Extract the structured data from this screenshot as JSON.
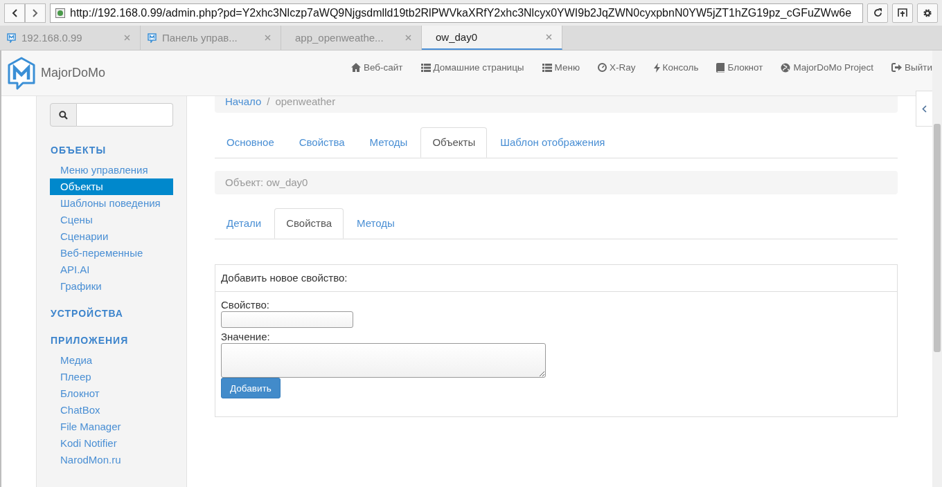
{
  "browser": {
    "url": "http://192.168.0.99/admin.php?pd=Y2xhc3Nlczp7aWQ9Njgsdmlld19tb2RlPWVkaXRfY2xhc3Nlcyx0YWI9b2JqZWN0cyxpbnN0YW5jZT1hZG19pz_cGFuZWw6e",
    "tabs": [
      {
        "label": "192.168.0.99",
        "favicon": true,
        "selected": false
      },
      {
        "label": "Панель управ...",
        "favicon": true,
        "selected": false
      },
      {
        "label": "app_openweathe...",
        "favicon": false,
        "selected": false
      },
      {
        "label": "ow_day0",
        "favicon": false,
        "selected": true
      }
    ]
  },
  "navbar": {
    "brand": "MajorDoMo",
    "links": [
      {
        "label": "Веб-сайт",
        "kind": "home"
      },
      {
        "label": "Домашние страницы",
        "kind": "list"
      },
      {
        "label": "Меню",
        "kind": "list"
      },
      {
        "label": "X-Ray",
        "kind": "gauge"
      },
      {
        "label": "Консоль",
        "kind": "bolt"
      },
      {
        "label": "Блокнот",
        "kind": "book"
      },
      {
        "label": "MajorDoMo Project",
        "kind": "globe"
      },
      {
        "label": "Выйти",
        "kind": "signout"
      }
    ]
  },
  "sidebar": {
    "sections": [
      {
        "title": "ОБЪЕКТЫ",
        "items": [
          {
            "label": "Меню управления",
            "selected": false
          },
          {
            "label": "Объекты",
            "selected": true
          },
          {
            "label": "Шаблоны поведения",
            "selected": false
          },
          {
            "label": "Сцены",
            "selected": false
          },
          {
            "label": "Сценарии",
            "selected": false
          },
          {
            "label": "Веб-переменные",
            "selected": false
          },
          {
            "label": "API.AI",
            "selected": false
          },
          {
            "label": "Графики",
            "selected": false
          }
        ]
      },
      {
        "title": "УСТРОЙСТВА"
      },
      {
        "title": "ПРИЛОЖЕНИЯ",
        "items": [
          {
            "label": "Медиа",
            "selected": false
          },
          {
            "label": "Плеер",
            "selected": false
          },
          {
            "label": "Блокнот",
            "selected": false
          },
          {
            "label": "ChatBox",
            "selected": false
          },
          {
            "label": "File Manager",
            "selected": false
          },
          {
            "label": "Kodi Notifier",
            "selected": false
          },
          {
            "label": "NarodMon.ru",
            "selected": false
          }
        ]
      }
    ]
  },
  "breadcrumb": {
    "separator": "/",
    "items": [
      {
        "label": "Начало",
        "link": true
      },
      {
        "label": "openweather",
        "link": false
      }
    ]
  },
  "tabs": [
    {
      "label": "Основное",
      "selected": false
    },
    {
      "label": "Свойства",
      "selected": false
    },
    {
      "label": "Методы",
      "selected": false
    },
    {
      "label": "Объекты",
      "selected": true
    },
    {
      "label": "Шаблон отображения",
      "selected": false
    }
  ],
  "object_heading": "Объект: ow_day0",
  "subtabs": [
    {
      "label": "Детали",
      "selected": false
    },
    {
      "label": "Свойства",
      "selected": true
    },
    {
      "label": "Методы",
      "selected": false
    }
  ],
  "form": {
    "title": "Добавить новое свойство:",
    "fields": [
      {
        "label": "Свойство:",
        "kind": "input"
      },
      {
        "label": "Значение:",
        "kind": "textarea"
      }
    ],
    "button": "Добавить"
  }
}
